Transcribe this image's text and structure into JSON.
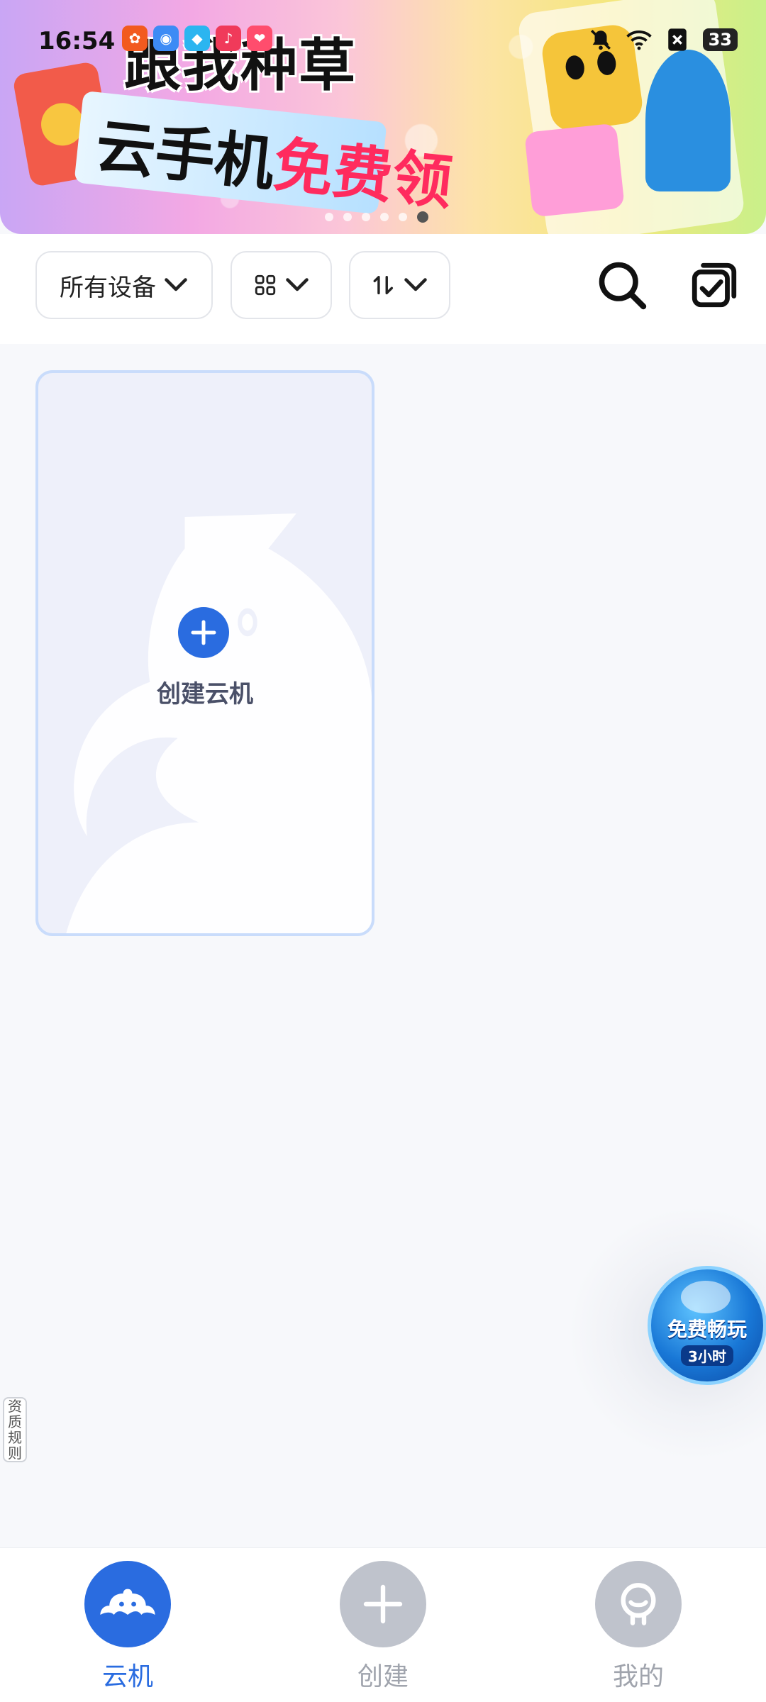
{
  "status_bar": {
    "time": "16:54",
    "battery": "33"
  },
  "banner": {
    "headline": "跟我种草",
    "subtitle_prefix": "云手机",
    "subtitle_highlight": "免费领",
    "dots_count": 6,
    "active_dot_index": 5
  },
  "toolbar": {
    "devices_filter": "所有设备",
    "grid_view_icon": "grid-icon",
    "sort_icon": "sort-icon",
    "search_icon": "search-icon",
    "multi_select_icon": "multi-select-icon"
  },
  "create_card": {
    "label": "创建云机"
  },
  "float_promo": {
    "title": "免费畅玩",
    "subtitle": "3小时"
  },
  "rules_tag": "资质规则",
  "tabbar": {
    "tabs": [
      {
        "label": "云机",
        "active": true,
        "icon": "cloud-mascot-icon"
      },
      {
        "label": "创建",
        "active": false,
        "icon": "plus-icon"
      },
      {
        "label": "我的",
        "active": false,
        "icon": "profile-icon"
      }
    ]
  },
  "colors": {
    "accent": "#2a6ce0",
    "inactive": "#bfc3cc",
    "card_border": "#c9dcfb"
  }
}
